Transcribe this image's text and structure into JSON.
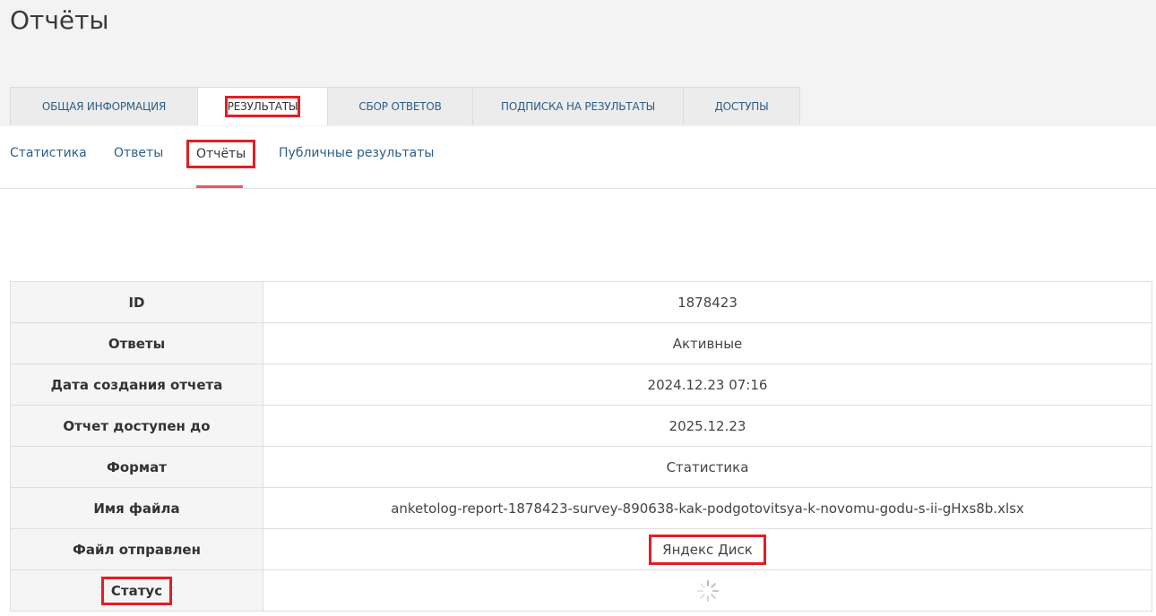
{
  "page_title": "Отчёты",
  "main_tabs": [
    {
      "label": "ОБЩАЯ ИНФОРМАЦИЯ"
    },
    {
      "label": "РЕЗУЛЬТАТЫ"
    },
    {
      "label": "СБОР ОТВЕТОВ"
    },
    {
      "label": "ПОДПИСКА НА РЕЗУЛЬТАТЫ"
    },
    {
      "label": "ДОСТУПЫ"
    }
  ],
  "sub_tabs": [
    {
      "label": "Статистика"
    },
    {
      "label": "Ответы"
    },
    {
      "label": "Отчёты"
    },
    {
      "label": "Публичные результаты"
    }
  ],
  "report": {
    "rows": [
      {
        "key": "ID",
        "value": "1878423"
      },
      {
        "key": "Ответы",
        "value": "Активные"
      },
      {
        "key": "Дата создания отчета",
        "value": "2024.12.23 07:16"
      },
      {
        "key": "Отчет доступен до",
        "value": "2025.12.23"
      },
      {
        "key": "Формат",
        "value": "Статистика"
      },
      {
        "key": "Имя файла",
        "value": "anketolog-report-1878423-survey-890638-kak-podgotovitsya-k-novomu-godu-s-ii-gHxs8b.xlsx"
      },
      {
        "key": "Файл отправлен",
        "value": "Яндекс Диск"
      },
      {
        "key": "Статус",
        "value_icon": "loading-spinner-icon"
      }
    ]
  },
  "colors": {
    "link": "#2d5e8a",
    "highlight": "#e31e24",
    "active_underline": "#e35a63"
  }
}
